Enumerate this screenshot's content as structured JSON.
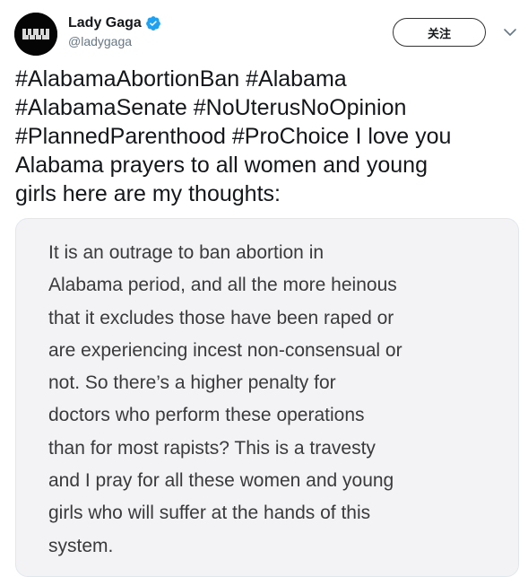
{
  "user": {
    "display_name": "Lady Gaga",
    "handle": "@ladygaga",
    "verified": true,
    "avatar_icon": "avatar-piano-keys"
  },
  "follow_button": {
    "label": "关注"
  },
  "menu": {
    "icon": "chevron-down-icon"
  },
  "tweet": {
    "lines": [
      "#AlabamaAbortionBan #Alabama",
      "#AlabamaSenate #NoUterusNoOpinion",
      "#PlannedParenthood #ProChoice I love you",
      "Alabama prayers to all women and young",
      "girls here are my thoughts:"
    ]
  },
  "note_image": {
    "lines": [
      "It is an outrage to ban abortion in",
      "Alabama period, and all the more heinous",
      "that it excludes those have been raped or",
      "are experiencing incest non-consensual or",
      "not. So there’s a higher penalty for",
      "doctors who perform these operations",
      "than for most rapists? This is a travesty",
      "and I pray for all these women and young",
      "girls who will suffer at the hands of this",
      "system."
    ]
  },
  "colors": {
    "verified_blue": "#1da1f2",
    "secondary_text": "#657786",
    "note_background": "#f3f3f5"
  }
}
